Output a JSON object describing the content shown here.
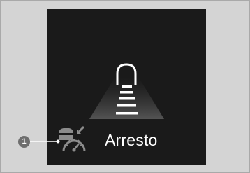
{
  "display": {
    "status_text": "Arresto",
    "status_icon": "acc-vehicle-speedometer-icon",
    "lane_graphic_icon": "vehicle-ahead-lane-icon"
  },
  "callout": {
    "number": "1"
  },
  "colors": {
    "screen_background": "#1a1a1a",
    "page_background": "#d4d4d4",
    "icon_gray": "#8c8c8c",
    "foreground": "#ffffff"
  }
}
